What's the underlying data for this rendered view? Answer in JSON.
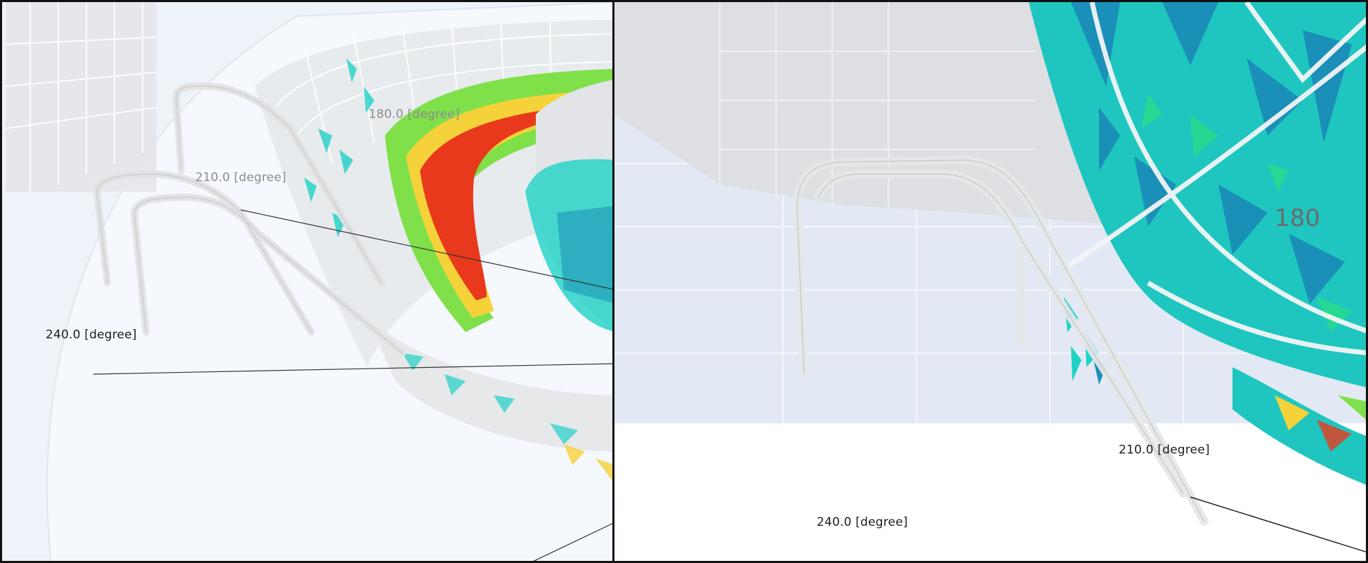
{
  "views": [
    {
      "id": "left-view",
      "labels": {
        "deg_180": "180.0 [degree]",
        "deg_210": "210.0 [degree]",
        "deg_240": "240.0 [degree]"
      }
    },
    {
      "id": "right-view",
      "labels": {
        "deg_180": "180",
        "deg_210": "210.0 [degree]",
        "deg_240": "240.0 [degree]"
      }
    }
  ],
  "colors": {
    "border": "#111111",
    "floor": "#eef3fa",
    "structure": "#e4e6e8",
    "contour_low": "#1a8fb8",
    "contour_mid": "#1fd2c6",
    "contour_green": "#7fe04a",
    "contour_yellow": "#f5d23a",
    "contour_high": "#e8391c"
  }
}
